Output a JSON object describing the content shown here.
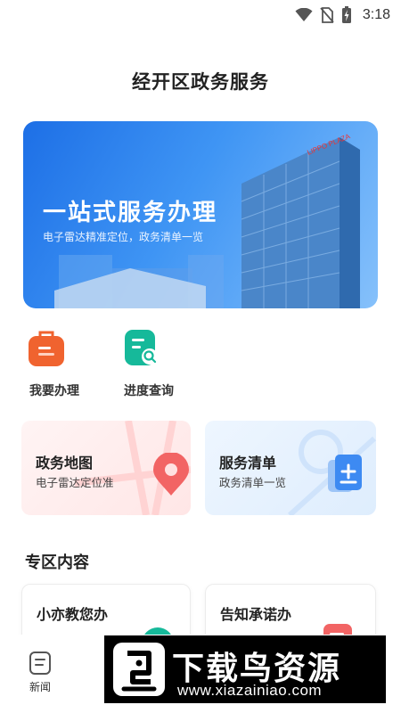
{
  "status_bar": {
    "time": "3:18"
  },
  "page": {
    "title": "经开区政务服务"
  },
  "banner": {
    "title": "一站式服务办理",
    "subtitle": "电子雷达精准定位，政务清单一览",
    "building_sign": "LIPPO PLAZA"
  },
  "quick_actions": [
    {
      "label": "我要办理",
      "icon": "briefcase-icon",
      "color": "#f0632f"
    },
    {
      "label": "进度查询",
      "icon": "document-search-icon",
      "color": "#16b99a"
    }
  ],
  "cards": [
    {
      "title": "政务地图",
      "subtitle": "电子雷达定位准",
      "icon": "map-pin-icon",
      "color": "#f26464"
    },
    {
      "title": "服务清单",
      "subtitle": "政务清单一览",
      "icon": "document-add-icon",
      "color": "#3d8af2"
    }
  ],
  "zone": {
    "title": "专区内容",
    "items": [
      {
        "title": "小亦教您办"
      },
      {
        "title": "告知承诺办"
      }
    ]
  },
  "bottom_nav": {
    "news_label": "新闻"
  },
  "watermark": {
    "title": "下载鸟资源",
    "url": "www.xiazainiao.com"
  },
  "colors": {
    "brand_blue": "#2b7cf0",
    "accent_orange": "#f0632f",
    "accent_teal": "#16b99a"
  }
}
